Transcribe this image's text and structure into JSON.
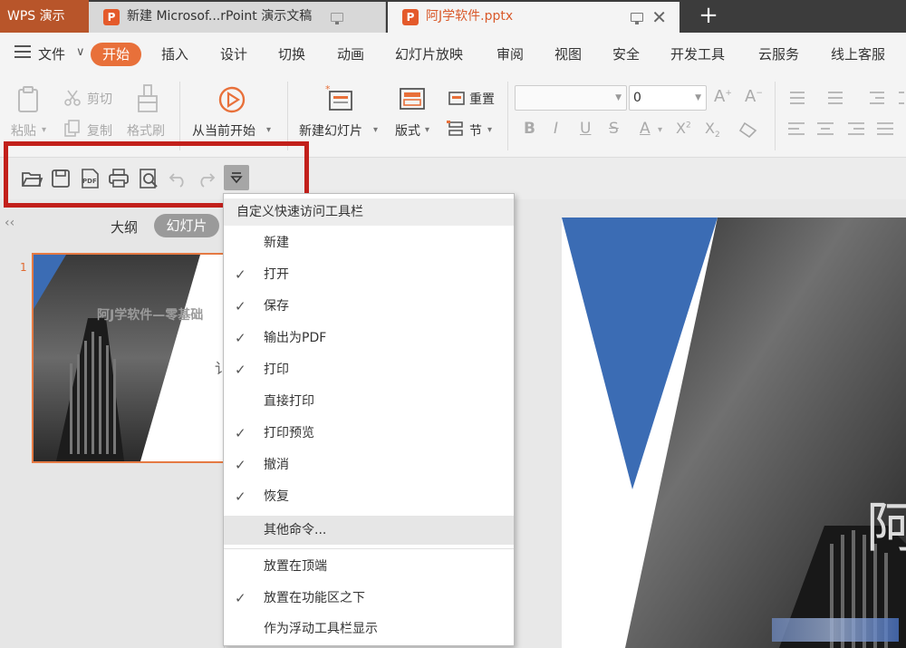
{
  "titlebar": {
    "app_name": "WPS 演示",
    "tabs": [
      {
        "label": "新建 Microsof...rPoint 演示文稿",
        "active": false
      },
      {
        "label": "阿J学软件.pptx",
        "active": true
      }
    ],
    "add_tab": "+",
    "close": "✕"
  },
  "menubar": {
    "file": "文件",
    "items": [
      "开始",
      "插入",
      "设计",
      "切换",
      "动画",
      "幻灯片放映",
      "审阅",
      "视图",
      "安全",
      "开发工具",
      "云服务",
      "线上客服"
    ]
  },
  "ribbon": {
    "paste": "粘贴",
    "cut": "剪切",
    "copy": "复制",
    "format_painter": "格式刷",
    "from_current": "从当前开始",
    "new_slide": "新建幻灯片",
    "layout": "版式",
    "reset": "重置",
    "section": "节",
    "font_size": "0"
  },
  "left_panel": {
    "outline_tab": "大纲",
    "slides_tab": "幻灯片",
    "slide_number": "1",
    "thumb_title": "阿J学软件—零基础",
    "thumb_text": "讠"
  },
  "slide": {
    "big_char": "阿"
  },
  "dropdown": {
    "header": "自定义快速访问工具栏",
    "items": [
      {
        "label": "新建",
        "checked": false
      },
      {
        "label": "打开",
        "checked": true
      },
      {
        "label": "保存",
        "checked": true
      },
      {
        "label": "输出为PDF",
        "checked": true
      },
      {
        "label": "打印",
        "checked": true
      },
      {
        "label": "直接打印",
        "checked": false
      },
      {
        "label": "打印预览",
        "checked": true
      },
      {
        "label": "撤消",
        "checked": true
      },
      {
        "label": "恢复",
        "checked": true
      },
      {
        "label": "其他命令...",
        "checked": false
      },
      {
        "label": "放置在顶端",
        "checked": false
      },
      {
        "label": "放置在功能区之下",
        "checked": true
      },
      {
        "label": "作为浮动工具栏显示",
        "checked": false
      }
    ],
    "check_glyph": "✓"
  },
  "colors": {
    "accent": "#e8703a",
    "title_bg": "#3c3c3c",
    "highlight": "#c2201b",
    "slide_blue": "#3b6cb4"
  }
}
